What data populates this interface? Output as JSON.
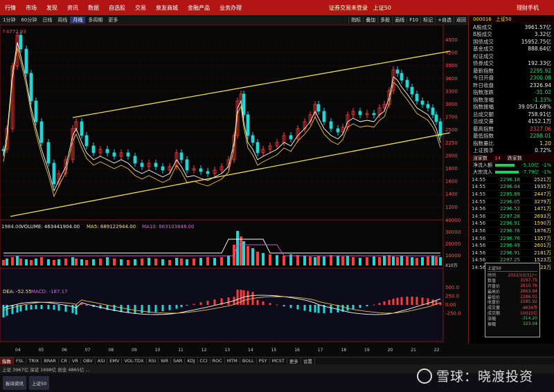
{
  "top_menu": {
    "items": [
      "行情",
      "市场",
      "发现",
      "资讯",
      "数据",
      "自选股",
      "交易",
      "泉友商城",
      "金融产品",
      "业务办理"
    ],
    "center_title": "证券交易未登录",
    "center_index": "上证50",
    "right_label": "理财手机"
  },
  "period_tabs": [
    "1分钟",
    "60分钟",
    "日线",
    "周线",
    "月线",
    "多周期",
    "更多"
  ],
  "active_period": "月线",
  "toolbar": [
    "指标",
    "叠加",
    "多股",
    "画线",
    "F10",
    "标记",
    "+自选",
    "返回"
  ],
  "chart": {
    "peak_label": "4772.93",
    "price_axis": [
      "4500",
      "4200",
      "3900",
      "3600",
      "3300",
      "3000",
      "2700",
      "2500",
      "2250",
      "2000",
      "1800",
      "1600",
      "1400",
      "1200"
    ],
    "volume_axis": [
      "40000",
      "30000",
      "20000",
      "10000"
    ],
    "volume_unit": "X10万",
    "macd_axis": [
      "500.0",
      "250.0",
      "0.00",
      "-250.0"
    ],
    "volume_legend": {
      "vol": "VOLUME: 463441904.00",
      "ma5": "MA5: 689122944.00",
      "ma10": "MA10: 663103848.00"
    },
    "left_value": "1984.00",
    "macd_legend": {
      "dea": "DEA: -52.55",
      "macd": "MACD: -187.17"
    },
    "x_axis_years": [
      "04",
      "05",
      "06",
      "07",
      "08",
      "09",
      "10",
      "11",
      "12",
      "13",
      "14",
      "15",
      "16",
      "17",
      "18",
      "19",
      "20",
      "21",
      "22"
    ],
    "colors": {
      "up": "#ff3b3b",
      "down": "#20d6d6",
      "channel": "#f0e040",
      "ma_white": "#ffffff",
      "ma_yellow": "#f0c040",
      "ma_purple": "#d050d0"
    }
  },
  "stock_header": {
    "code": "000016",
    "name": "上证50"
  },
  "stats": [
    {
      "k": "A股成交",
      "v": "3961.57亿",
      "c": "w"
    },
    {
      "k": "B股成交",
      "v": "3.32亿",
      "c": "w"
    },
    {
      "k": "国债成交",
      "v": "15952.75亿",
      "c": "w"
    },
    {
      "k": "基金成交",
      "v": "888.64亿",
      "c": "w"
    },
    {
      "k": "权证成交",
      "v": "",
      "c": "w"
    },
    {
      "k": "债券成交",
      "v": "192.33亿",
      "c": "w"
    },
    {
      "k": "最新指数",
      "v": "2295.92",
      "c": "g"
    },
    {
      "k": "今日开盘",
      "v": "2300.08",
      "c": "g"
    },
    {
      "k": "昨日收盘",
      "v": "2326.94",
      "c": "w"
    },
    {
      "k": "指数涨跌",
      "v": "-31.02",
      "c": "g"
    },
    {
      "k": "指数涨幅",
      "v": "-1.33%",
      "c": "g"
    },
    {
      "k": "指数振幅",
      "v": "39.05/1.68%",
      "c": "w"
    },
    {
      "k": "总成交额",
      "v": "758.91亿",
      "c": "w"
    },
    {
      "k": "总成交量",
      "v": "4152.1万",
      "c": "w"
    },
    {
      "k": "最高指数",
      "v": "2327.06",
      "c": "r"
    },
    {
      "k": "最低指数",
      "v": "2288.01",
      "c": "g"
    },
    {
      "k": "指数量比",
      "v": "1.20",
      "c": "y"
    },
    {
      "k": "上证换手",
      "v": "0.72%",
      "c": "w"
    }
  ],
  "flow": {
    "up_label": "涨家数",
    "up_value": "14",
    "down_label": "跌家数",
    "net_label": "净流入额",
    "net_value": "-5.10亿",
    "net_pct": "-1%",
    "big_label": "大宗流入",
    "big_value": "-7.79亿",
    "big_pct": "-1%"
  },
  "ticks": [
    {
      "t": "14:55",
      "p": "2296.18",
      "v": "2521万"
    },
    {
      "t": "14:55",
      "p": "2296.04",
      "v": "1935万"
    },
    {
      "t": "14:55",
      "p": "2295.89",
      "v": "2447万"
    },
    {
      "t": "14:55",
      "p": "2296.05",
      "v": "3279万"
    },
    {
      "t": "14:56",
      "p": "2296.52",
      "v": "1471万"
    },
    {
      "t": "14:56",
      "p": "2297.28",
      "v": "2693万"
    },
    {
      "t": "14:56",
      "p": "2296.91",
      "v": "1590万"
    },
    {
      "t": "14:56",
      "p": "2296.78",
      "v": "1876万"
    },
    {
      "t": "14:56",
      "p": "2296.76",
      "v": "1357万"
    },
    {
      "t": "14:56",
      "p": "2296.49",
      "v": "2601万"
    },
    {
      "t": "14:56",
      "p": "2296.91",
      "v": "2181万"
    },
    {
      "t": "14:56",
      "p": "2297.25",
      "v": "1523万"
    },
    {
      "t": "14:56",
      "p": "2297.06",
      "v": "1523万"
    }
  ],
  "info_box": {
    "title": "上证50",
    "rows": [
      {
        "k": "时间",
        "v": "2022/10/31/一"
      },
      {
        "k": "数值",
        "v": "3197.75"
      },
      {
        "k": "开盘价",
        "v": "2610.76"
      },
      {
        "k": "最高价",
        "v": "2663.94"
      },
      {
        "k": "最低价",
        "v": "2286.01"
      },
      {
        "k": "收盘价",
        "v": "2285.92"
      },
      {
        "k": "成交量",
        "v": "4634万"
      },
      {
        "k": "成交额",
        "v": "10015亿"
      },
      {
        "k": "涨幅",
        "v": "-314.20"
      },
      {
        "k": "振幅",
        "v": "323.04"
      }
    ]
  },
  "bottom_tabs": [
    "指数",
    "FSL",
    "TRIX",
    "BRAR",
    "CR",
    "VR",
    "OBV",
    "ASI",
    "EMV",
    "VOL-TDX",
    "RSI",
    "WR",
    "SAR",
    "KDJ",
    "CCI",
    "ROC",
    "MTM",
    "BOLL",
    "PSY",
    "MCST",
    "更多",
    "设置"
  ],
  "active_bottom_tab": "指数",
  "status_text": "上证 3967亿  深证 1698亿  创业 4865亿  ...",
  "taskbar": [
    "板块资讯",
    "上证50"
  ],
  "watermark": "雪球：晓渡投资"
}
